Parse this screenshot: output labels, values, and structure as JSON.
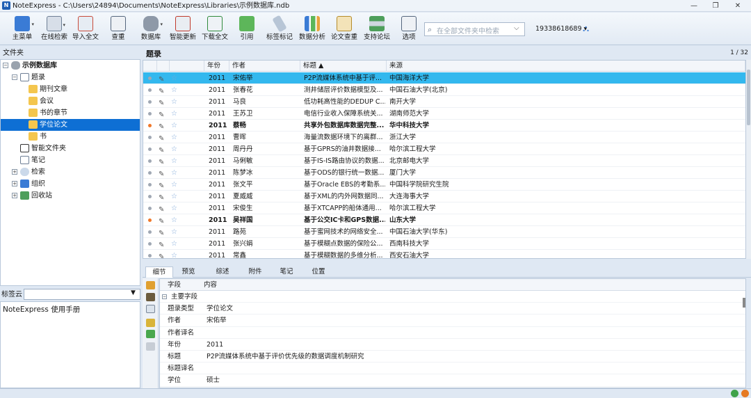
{
  "window": {
    "app_badge": "N",
    "title": "NoteExpress - C:\\Users\\24894\\Documents\\NoteExpress\\Libraries\\示例数据库.ndb"
  },
  "toolbar": {
    "buttons": [
      "主菜单",
      "在线检索",
      "导入全文",
      "查重",
      "数据库",
      "智能更新",
      "下载全文",
      "引用",
      "标签标记",
      "数据分析",
      "论文查重",
      "支持论坛",
      "选项"
    ],
    "search_placeholder": "在全部文件夹中检索",
    "account": "19338618689 ▾"
  },
  "left": {
    "header": "文件夹",
    "tree": [
      {
        "label": "示例数据库",
        "bold": true
      },
      {
        "label": "题录"
      },
      {
        "label": "期刊文章"
      },
      {
        "label": "会议"
      },
      {
        "label": "书的章节"
      },
      {
        "label": "学位论文",
        "selected": true
      },
      {
        "label": "书"
      },
      {
        "label": "智能文件夹"
      },
      {
        "label": "笔记"
      },
      {
        "label": "检索"
      },
      {
        "label": "组织"
      },
      {
        "label": "回收站"
      }
    ],
    "tagcloud_label": "标签云",
    "tagcloud_item": "NoteExpress  使用手册"
  },
  "list": {
    "title": "题录",
    "page": "1 / 32",
    "columns": [
      "年份",
      "作者",
      "标题 ▲",
      "来源"
    ],
    "rows": [
      {
        "year": "2011",
        "author": "宋佑举",
        "title": "P2P流媒体系统中基于评...",
        "source": "中国海洋大学",
        "selected": true
      },
      {
        "year": "2011",
        "author": "张春花",
        "title": "测井储层评价数据模型及...",
        "source": "中国石油大学(北京)"
      },
      {
        "year": "2011",
        "author": "马良",
        "title": "低功耗高性能的DEDUP C...",
        "source": "南开大学"
      },
      {
        "year": "2011",
        "author": "王苏卫",
        "title": "电信行业收入保障系统关...",
        "source": "湖南师范大学"
      },
      {
        "year": "2011",
        "author": "蔡畅",
        "title": "共享外包数据库数据完整...",
        "source": "华中科技大学",
        "bold": true
      },
      {
        "year": "2011",
        "author": "曹晖",
        "title": "海量流数据环境下的离群...",
        "source": "浙江大学"
      },
      {
        "year": "2011",
        "author": "周丹丹",
        "title": "基于GPRS的油井数据接...",
        "source": "哈尔滨工程大学"
      },
      {
        "year": "2011",
        "author": "马俐敏",
        "title": "基于IS-IS路由协议的数据...",
        "source": "北京邮电大学"
      },
      {
        "year": "2011",
        "author": "陈梦冰",
        "title": "基于ODS的银行统一数据...",
        "source": "厦门大学"
      },
      {
        "year": "2011",
        "author": "张文平",
        "title": "基于Oracle EBS的考勤系...",
        "source": "中国科学院研究生院"
      },
      {
        "year": "2011",
        "author": "夏威威",
        "title": "基于XML的内外网数据同...",
        "source": "大连海事大学"
      },
      {
        "year": "2011",
        "author": "宋俊生",
        "title": "基于XTCAPP的船体通用...",
        "source": "哈尔滨工程大学"
      },
      {
        "year": "2011",
        "author": "吴祥国",
        "title": "基于公交IC卡和GPS数据...",
        "source": "山东大学",
        "bold": true
      },
      {
        "year": "2011",
        "author": "路苑",
        "title": "基于蜜网技术的网络安全...",
        "source": "中国石油大学(华东)"
      },
      {
        "year": "2011",
        "author": "张兴娟",
        "title": "基于模糊点数据的保险公...",
        "source": "西南科技大学"
      },
      {
        "year": "2011",
        "author": "常鑫",
        "title": "基于模糊数据的多维分析...",
        "source": "西安石油大学"
      }
    ]
  },
  "detail": {
    "tabs": [
      "细节",
      "预览",
      "综述",
      "附件",
      "笔记",
      "位置"
    ],
    "head": [
      "字段",
      "内容"
    ],
    "group": "主要字段",
    "fields": [
      {
        "f": "题录类型",
        "v": "学位论文"
      },
      {
        "f": "作者",
        "v": "宋佑举"
      },
      {
        "f": "作者译名",
        "v": ""
      },
      {
        "f": "年份",
        "v": "2011"
      },
      {
        "f": "标题",
        "v": "P2P流媒体系统中基于评价优先级的数据调度机制研究"
      },
      {
        "f": "标题译名",
        "v": ""
      },
      {
        "f": "学位",
        "v": "硕士"
      }
    ]
  },
  "colors": {
    "selection": "#0e6fd4",
    "row_selected": "#33b8ee",
    "unread": "#f0782a"
  }
}
